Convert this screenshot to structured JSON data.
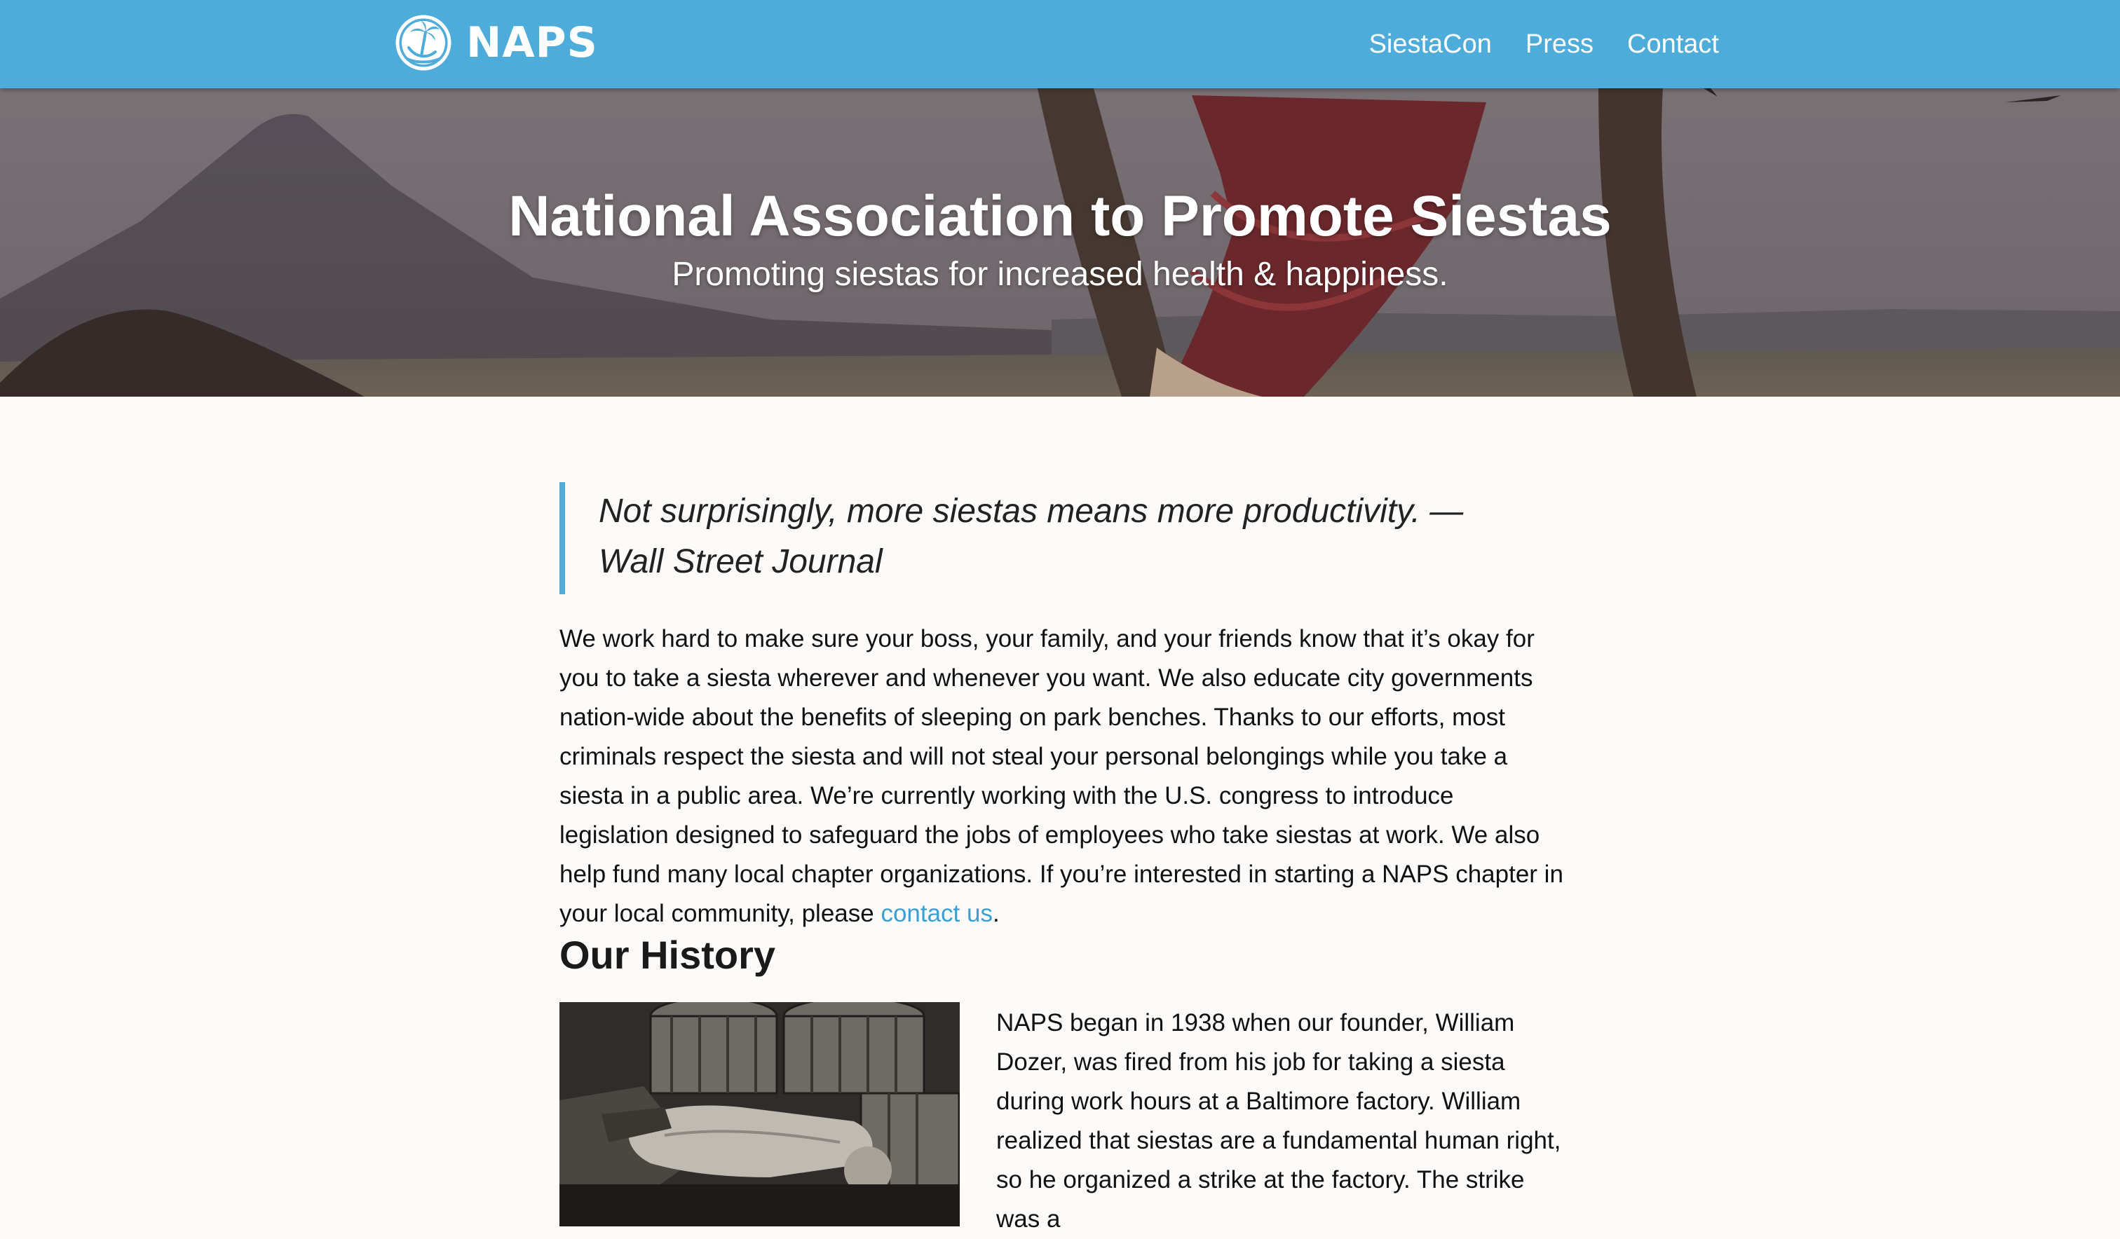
{
  "nav": {
    "logo_text": "NAPS",
    "links": [
      "SiestaCon",
      "Press",
      "Contact"
    ]
  },
  "hero": {
    "title": "National Association to Promote Siestas",
    "subtitle": "Promoting siestas for increased health & happiness."
  },
  "quote": {
    "text": "Not surprisingly, more siestas means more productivity. — Wall Street Journal"
  },
  "intro": {
    "text": "We work hard to make sure your boss, your family, and your friends know that it’s okay for you to take a siesta wherever and whenever you want. We also educate city governments nation-wide about the benefits of sleeping on park benches. Thanks to our efforts, most criminals respect the siesta and will not steal your personal belongings while you take a siesta in a public area. We’re currently working with the U.S. congress to introduce legislation designed to safeguard the jobs of employees who take siestas at work. We also help fund many local chapter organizations. If you’re interested in starting a NAPS chapter in your local community, please ",
    "link_text": "contact us",
    "end": "."
  },
  "history": {
    "heading": "Our History",
    "text": "NAPS began in 1938 when our founder, William Dozer, was fired from his job for taking a siesta during work hours at a Baltimore factory. William realized that siestas are a fundamental human right, so he organized a strike at the factory. The strike was a"
  },
  "colors": {
    "nav_bg": "#4dacd9",
    "accent": "#4dacd9",
    "link": "#3a9fd2",
    "page_bg": "#fcfbfa"
  },
  "icons": {
    "logo": "palm-tree-hammock-icon"
  }
}
